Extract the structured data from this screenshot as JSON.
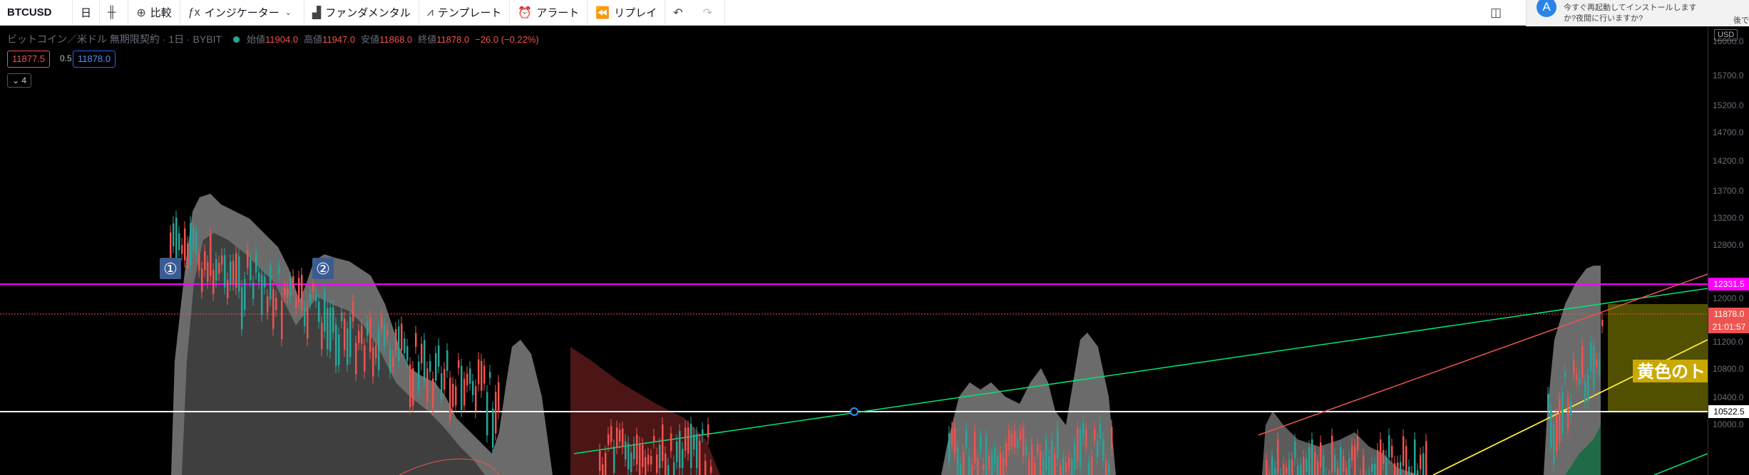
{
  "toolbar": {
    "symbol": "BTCUSD",
    "interval": "日",
    "compare_label": "比較",
    "indicators_label": "インジケーター",
    "fundamental_label": "ファンダメンタル",
    "template_label": "テンプレート",
    "alert_label": "アラート",
    "replay_label": "リプレイ"
  },
  "notification": {
    "message": "今すぐ再起動してインストールしますか?夜間に行いますか?",
    "later_label": "後で"
  },
  "legend": {
    "title": "ビットコイン／米ドル 無期限契約 · 1日 · BYBIT",
    "open_label": "始値",
    "open": "11904.0",
    "high_label": "高値",
    "high": "11947.0",
    "low_label": "安値",
    "low": "11868.0",
    "close_label": "終値",
    "close": "11878.0",
    "change": "−26.0 (−0.22%)",
    "bid": "11877.5",
    "spread": "0.5",
    "ask": "11878.0",
    "collapse_count": "4"
  },
  "markers": {
    "m1": "①",
    "m2": "②"
  },
  "annotation_text": "黄色のト",
  "axis": {
    "currency": "USD",
    "ticks": [
      "16000.0",
      "15700.0",
      "15200.0",
      "14700.0",
      "14200.0",
      "13700.0",
      "13200.0",
      "12800.0",
      "12000.0",
      "11200.0",
      "10800.0",
      "10400.0",
      "10000.0"
    ],
    "magenta_level": "12331.5",
    "last_price": "11878.0",
    "countdown": "21:01:57",
    "white_level": "10522.5"
  },
  "colors": {
    "magenta": "#ff00ff",
    "last_price": "#ef5350",
    "green_line": "#00e676",
    "yellow_line": "#ffeb3b",
    "up_candle": "#26a69a",
    "down_candle": "#ef5350"
  }
}
